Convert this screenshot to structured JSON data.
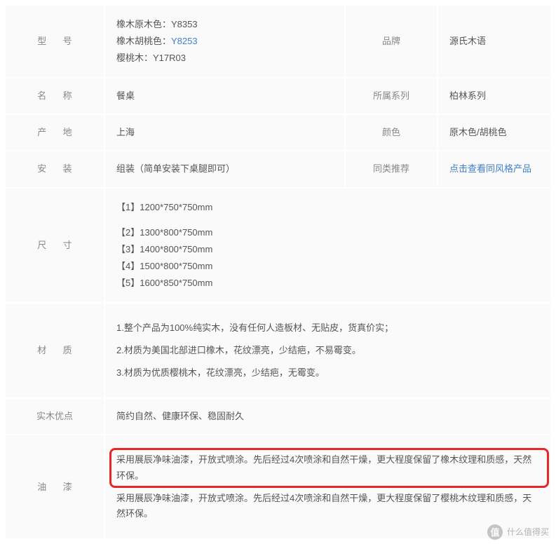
{
  "rows": {
    "model": {
      "label": "型号",
      "lines": [
        {
          "prefix": "橡木原木色：",
          "code": "Y8353",
          "link": false
        },
        {
          "prefix": "橡木胡桃色：",
          "code": "Y8253",
          "link": true
        },
        {
          "prefix": "樱桃木：",
          "code": "Y17R03",
          "link": false
        }
      ],
      "label2": "品牌",
      "value2": "源氏木语"
    },
    "name": {
      "label": "名称",
      "value": "餐桌",
      "label2": "所属系列",
      "value2": "柏林系列"
    },
    "origin": {
      "label": "产地",
      "value": "上海",
      "label2": "颜色",
      "value2": "原木色/胡桃色"
    },
    "install": {
      "label": "安装",
      "value": "组装（简单安装下桌腿即可）",
      "label2": "同类推荐",
      "value2": "点击查看同风格产品",
      "value2_link": true
    },
    "size": {
      "label": "尺寸",
      "items": [
        "【1】1200*750*750mm",
        "【2】1300*800*750mm",
        "【3】1400*800*750mm",
        "【4】1500*800*750mm",
        "【5】1600*850*750mm"
      ]
    },
    "material": {
      "label": "材质",
      "paras": [
        "1.整个产品为100%纯实木，没有任何人造板材、无贴皮，货真价实；",
        "2.材质为美国北部进口橡木，花纹漂亮，少结疤，不易霉变。",
        "3.材质为优质樱桃木，花纹漂亮，少结疤，无霉变。"
      ]
    },
    "advantage": {
      "label": "实木优点",
      "value": "简约自然、健康环保、稳固耐久"
    },
    "paint": {
      "label": "油漆",
      "paras": [
        "采用展辰净味油漆，开放式喷涂。先后经过4次喷涂和自然干燥，更大程度保留了橡木纹理和质感，天然环保。",
        "采用展辰净味油漆，开放式喷涂。先后经过4次喷涂和自然干燥，更大程度保留了樱桃木纹理和质感，天然环保。"
      ]
    }
  },
  "watermark": "什么值得买"
}
